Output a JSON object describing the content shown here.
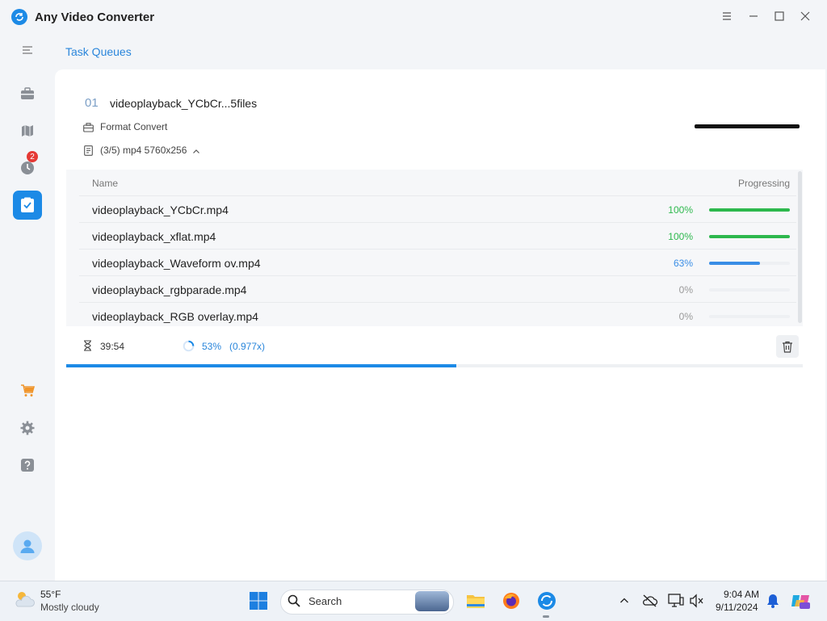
{
  "app": {
    "title": "Any Video Converter"
  },
  "page": {
    "title": "Task Queues"
  },
  "sidebar": {
    "history_badge": "2"
  },
  "task": {
    "number": "01",
    "name": "videoplayback_YCbCr...5files",
    "type": "Format Convert",
    "info": "(3/5) mp4 5760x256"
  },
  "table": {
    "col_name": "Name",
    "col_progress": "Progressing",
    "rows": [
      {
        "name": "videoplayback_YCbCr.mp4",
        "percent": "100%",
        "progress": 100,
        "color": "#2db84d"
      },
      {
        "name": "videoplayback_xflat.mp4",
        "percent": "100%",
        "progress": 100,
        "color": "#2db84d"
      },
      {
        "name": "videoplayback_Waveform ov.mp4",
        "percent": "63%",
        "progress": 63,
        "color": "#3a8ee6"
      },
      {
        "name": "videoplayback_rgbparade.mp4",
        "percent": "0%",
        "progress": 0,
        "color": "#999999"
      },
      {
        "name": "videoplayback_RGB overlay.mp4",
        "percent": "0%",
        "progress": 0,
        "color": "#999999"
      }
    ]
  },
  "footer": {
    "time_left": "39:54",
    "overall_percent": "53%",
    "speed": "(0.977x)",
    "overall_progress": 53
  },
  "taskbar": {
    "weather_temp": "55°F",
    "weather_desc": "Mostly cloudy",
    "search_label": "Search",
    "time": "9:04 AM",
    "date": "9/11/2024"
  },
  "colors": {
    "accent": "#1c8ae6",
    "success": "#2db84d",
    "badge": "#e53935"
  }
}
